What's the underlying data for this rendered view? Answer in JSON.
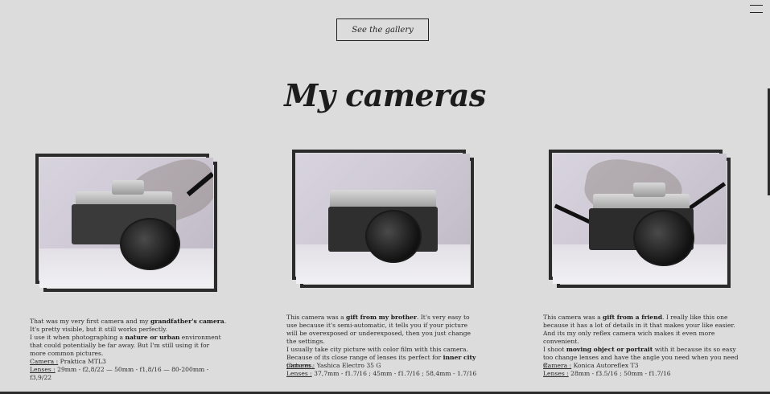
{
  "header": {
    "gallery_button": "See the gallery",
    "heading": "My cameras"
  },
  "cameras": [
    {
      "paragraph1_pre": "That was my very first camera and my ",
      "paragraph1_bold": "grandfather's camera",
      "paragraph1_post": ". It's pretty visible, but it still works perfectly.",
      "paragraph2_pre": "I use it when photographing a ",
      "paragraph2_bold": "nature or urban",
      "paragraph2_post": " environment that could potentially be far away. But I'm still using it for more common pictures.",
      "camera_label": "Camera :",
      "camera_value": " Praktica MTL3",
      "lenses_label": "Lenses :",
      "lenses_value": " 29mm - f2,8/22 — 50mm - f1,8/16 — 80-200mm - f3,9/22",
      "photo_alt": "Praktica MTL3 camera"
    },
    {
      "paragraph1_pre": "This camera was a ",
      "paragraph1_bold": "gift from my brother",
      "paragraph1_post": ". It's very easy to use because it's semi-automatic, it tells you if your picture will be overexposed or underexposed, then you just change the settings.",
      "paragraph2_pre": "I usually take city picture with color film with this camera. Because of its close range of lenses its perfect for ",
      "paragraph2_bold": "inner city",
      "paragraph2_post": " pictures.",
      "camera_label": "Camera :",
      "camera_value": " Yashica Electro 35 G",
      "lenses_label": "Lenses :",
      "lenses_value": " 37,7mm - f1.7/16 ; 45mm - f1.7/16 ; 58,4mm - 1.7/16",
      "photo_alt": "Yashica Electro 35 G camera"
    },
    {
      "paragraph1_pre": "This camera was a ",
      "paragraph1_bold": "gift from a friend",
      "paragraph1_post": ". I really like this one because it has a lot of details in it that makes your like easier. And its my only reflex camera wich makes it even more convenient.",
      "paragraph2_pre": "I shoot ",
      "paragraph2_bold": "moving object or portrait",
      "paragraph2_post": " with it because its so easy too change lenses and have the angle you need when you need it.",
      "camera_label": "Camera :",
      "camera_value": " Konica Autoreflex T3",
      "lenses_label": "Lenses :",
      "lenses_value": " 28mm - f3.5/16 ; 50mm - f1.7/16",
      "photo_alt": "Konica Autoreflex T3 camera"
    }
  ]
}
